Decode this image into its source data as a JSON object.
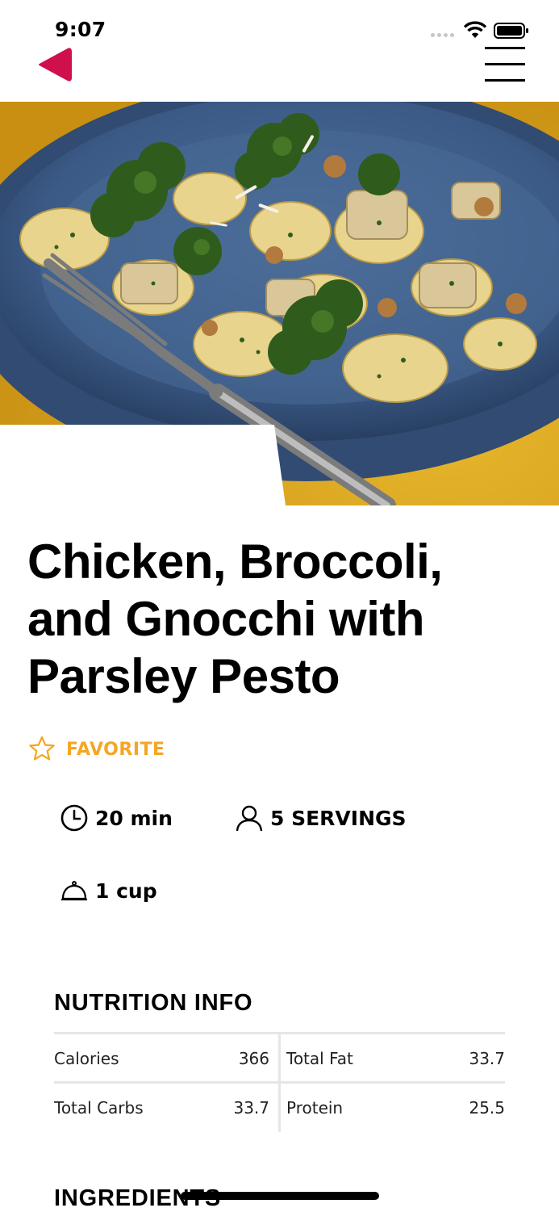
{
  "status_bar": {
    "time": "9:07"
  },
  "nav": {
    "back_icon": "back-triangle-icon",
    "menu_icon": "hamburger-menu-icon",
    "accent_color": "#d0104c"
  },
  "hero": {
    "image": "chicken broccoli gnocchi dish on blue plate with fork"
  },
  "recipe": {
    "title": "Chicken, Broccoli, and Gnocchi with Parsley Pesto",
    "favorite": {
      "label": "FAVORITE",
      "icon": "star-outline-icon",
      "color": "#f5a623"
    },
    "time": {
      "icon": "clock-icon",
      "value": "20 min"
    },
    "servings": {
      "icon": "person-icon",
      "value": "5 SERVINGS"
    },
    "portion": {
      "icon": "cloche-icon",
      "value": "1 cup"
    }
  },
  "nutrition": {
    "title": "NUTRITION INFO",
    "rows": [
      [
        {
          "label": "Calories",
          "value": "366"
        },
        {
          "label": "Total Fat",
          "value": "33.7"
        }
      ],
      [
        {
          "label": "Total Carbs",
          "value": "33.7"
        },
        {
          "label": "Protein",
          "value": "25.5"
        }
      ]
    ]
  },
  "ingredients": {
    "title": "INGREDIENTS"
  }
}
